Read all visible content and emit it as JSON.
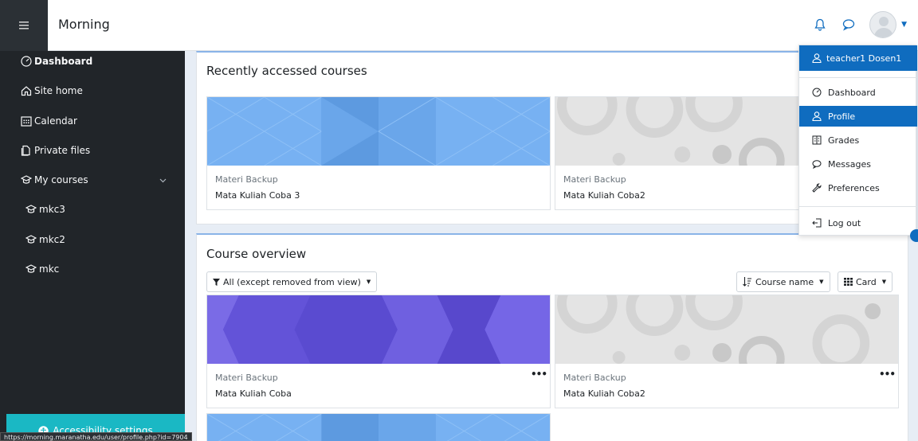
{
  "navbar": {
    "site_title": "Morning",
    "menu_icon": "hamburger-icon",
    "notifications_icon": "bell-icon",
    "messages_icon": "chat-bubble-icon",
    "avatar_icon": "user-avatar"
  },
  "sidebar": {
    "items": [
      {
        "label": "Dashboard",
        "icon": "gauge-icon"
      },
      {
        "label": "Site home",
        "icon": "home-icon"
      },
      {
        "label": "Calendar",
        "icon": "calendar-icon"
      },
      {
        "label": "Private files",
        "icon": "files-icon"
      },
      {
        "label": "My courses",
        "icon": "graduation-cap-icon"
      },
      {
        "label": "mkc3",
        "icon": "graduation-cap-icon"
      },
      {
        "label": "mkc2",
        "icon": "graduation-cap-icon"
      },
      {
        "label": "mkc",
        "icon": "graduation-cap-icon"
      }
    ],
    "accessibility_label": "Accessibility settings",
    "status_url": "https://morning.maranatha.edu/user/profile.php?id=7904"
  },
  "recent": {
    "title": "Recently accessed courses",
    "courses": [
      {
        "category": "Materi Backup",
        "name": "Mata Kuliah Coba 3"
      },
      {
        "category": "Materi Backup",
        "name": "Mata Kuliah Coba2"
      }
    ]
  },
  "overview": {
    "title": "Course overview",
    "filter_label": "All (except removed from view)",
    "sort_label": "Course name",
    "view_label": "Card",
    "courses": [
      {
        "category": "Materi Backup",
        "name": "Mata Kuliah Coba"
      },
      {
        "category": "Materi Backup",
        "name": "Mata Kuliah Coba2"
      }
    ]
  },
  "user_menu": {
    "user_name": "teacher1 Dosen1",
    "items": [
      {
        "label": "Dashboard",
        "icon": "gauge-icon"
      },
      {
        "label": "Profile",
        "icon": "user-icon"
      },
      {
        "label": "Grades",
        "icon": "grades-icon"
      },
      {
        "label": "Messages",
        "icon": "chat-bubble-icon"
      },
      {
        "label": "Preferences",
        "icon": "wrench-icon"
      },
      {
        "label": "Log out",
        "icon": "logout-icon"
      }
    ]
  },
  "colors": {
    "accent": "#0f6cbf",
    "sidebar_bg": "#212529",
    "accessibility_bg": "#1ab8c4"
  }
}
